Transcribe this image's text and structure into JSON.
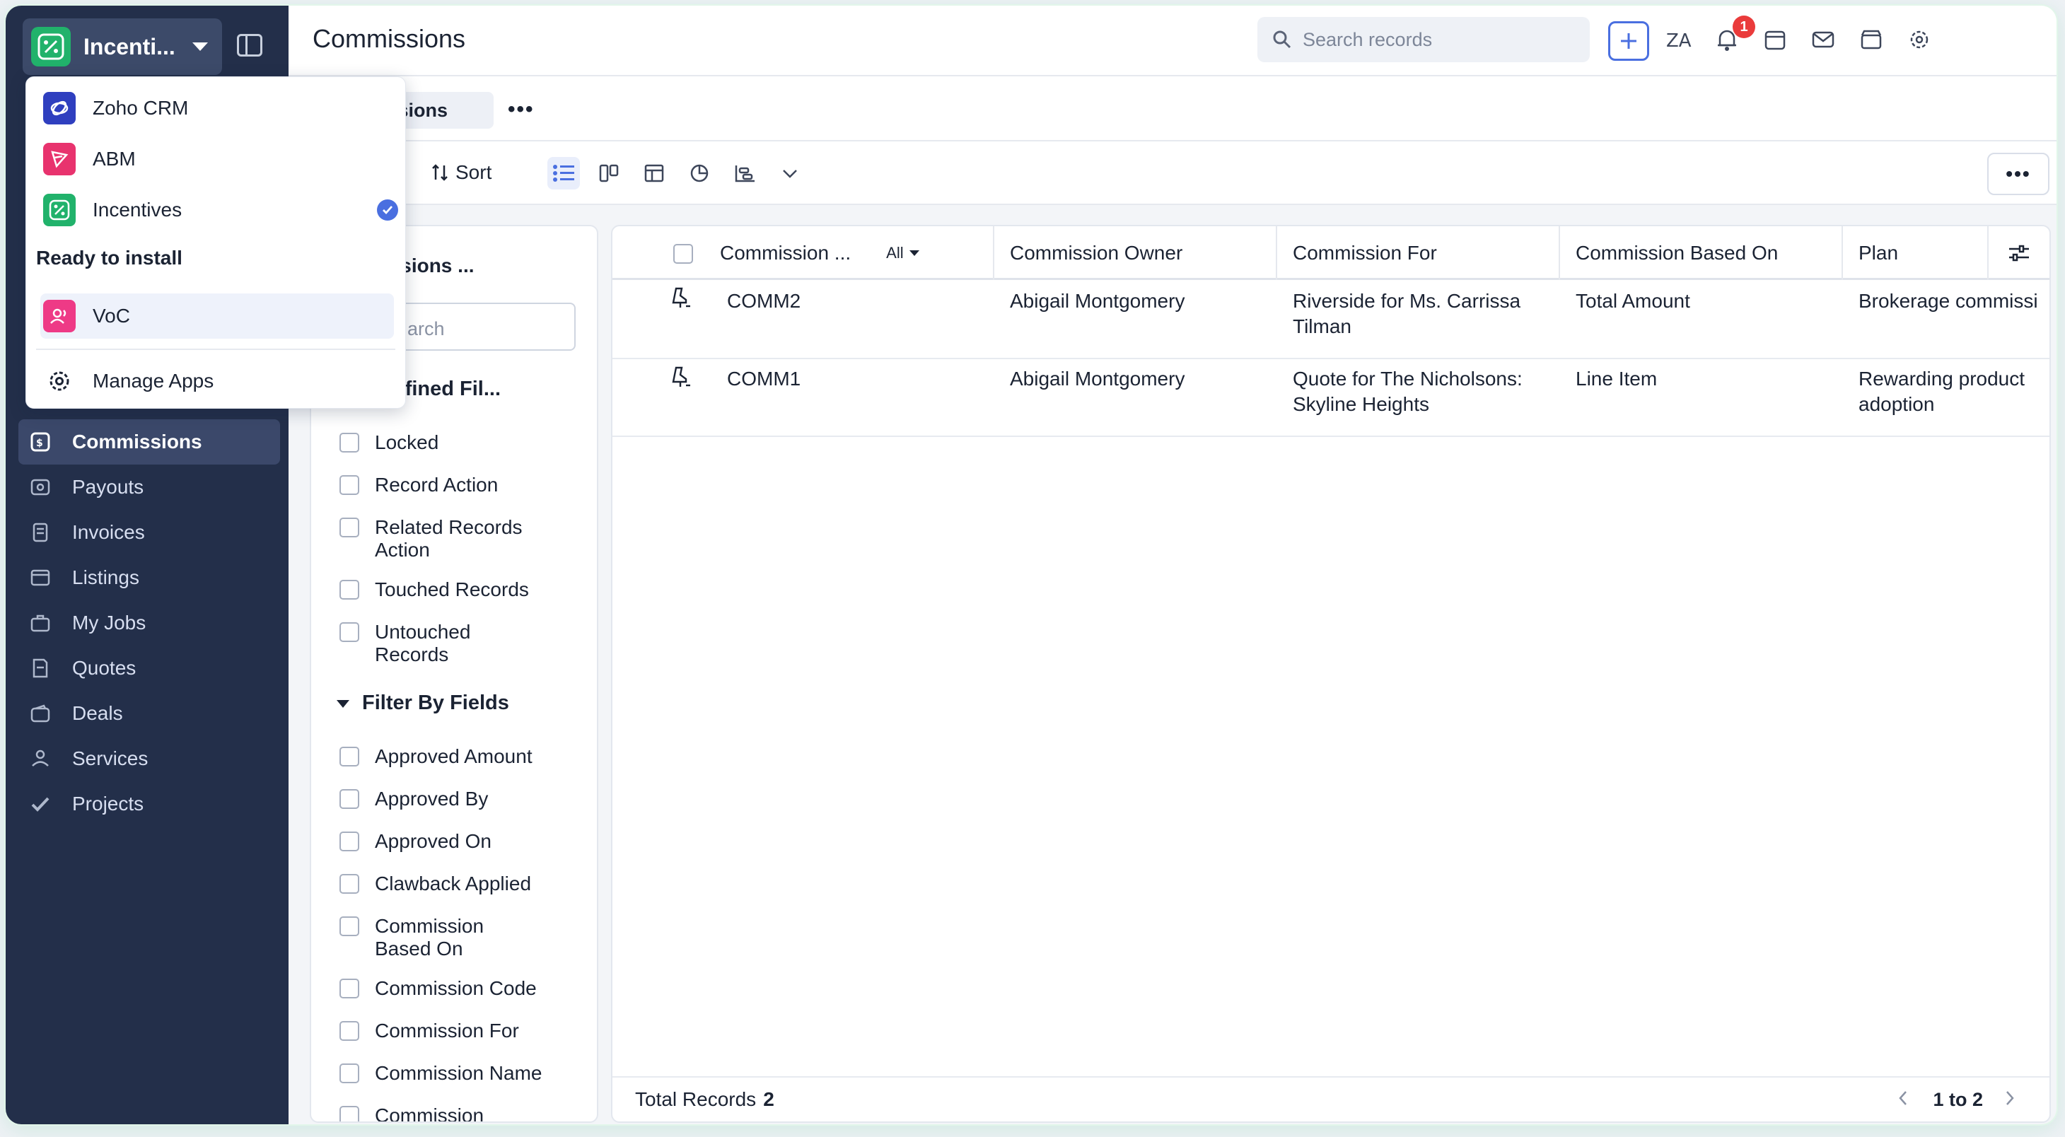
{
  "app_switcher": {
    "current_app": "Incenti...",
    "manage_apps": "Manage Apps"
  },
  "dropdown": {
    "installed": [
      {
        "label": "Zoho CRM",
        "color": "#2f3fbf",
        "selected": false
      },
      {
        "label": "ABM",
        "color": "#e8336e",
        "selected": false
      },
      {
        "label": "Incentives",
        "color": "#21b26b",
        "selected": true
      }
    ],
    "ready_section_label": "Ready to install",
    "ready": [
      {
        "label": "VoC",
        "color": "#ee3a86"
      }
    ]
  },
  "sidebar": {
    "items": [
      {
        "label": "Commissions",
        "icon": "commissions-icon",
        "active": true
      },
      {
        "label": "Payouts",
        "icon": "payouts-icon",
        "active": false
      },
      {
        "label": "Invoices",
        "icon": "invoices-icon",
        "active": false
      },
      {
        "label": "Listings",
        "icon": "listings-icon",
        "active": false
      },
      {
        "label": "My Jobs",
        "icon": "jobs-icon",
        "active": false
      },
      {
        "label": "Quotes",
        "icon": "quotes-icon",
        "active": false
      },
      {
        "label": "Deals",
        "icon": "deals-icon",
        "active": false
      },
      {
        "label": "Services",
        "icon": "services-icon",
        "active": false
      },
      {
        "label": "Projects",
        "icon": "projects-icon",
        "active": false
      }
    ]
  },
  "header": {
    "title": "Commissions",
    "search_placeholder": "Search records",
    "notification_count": "1"
  },
  "tabs": {
    "active_tab": "issions",
    "more": "•••"
  },
  "toolbar": {
    "sort_label": "Sort",
    "more_label": "•••"
  },
  "filter_panel": {
    "title": "ommissions ...",
    "search_placeholder": "arch",
    "system_section": "tem Defined Fil...",
    "system_filters": [
      "Locked",
      "Record Action",
      "Related Records Action",
      "Touched Records",
      "Untouched Records"
    ],
    "fields_section": "Filter By Fields",
    "field_filters": [
      "Approved Amount",
      "Approved By",
      "Approved On",
      "Clawback Applied",
      "Commission Based On",
      "Commission Code",
      "Commission For",
      "Commission Name",
      "Commission"
    ]
  },
  "table": {
    "columns": [
      "Commission ...",
      "Commission Owner",
      "Commission For",
      "Commission Based On",
      "Plan"
    ],
    "first_column_filter": "All",
    "rows": [
      {
        "code": "COMM2",
        "owner": "Abigail Montgomery",
        "for": "Riverside for Ms. Carrissa Tilman",
        "based_on": "Total Amount",
        "plan": "Brokerage commissi"
      },
      {
        "code": "COMM1",
        "owner": "Abigail Montgomery",
        "for": "Quote for The Nicholsons: Skyline Heights",
        "based_on": "Line Item",
        "plan": "Rewarding product adoption"
      }
    ],
    "footer_label": "Total Records",
    "footer_count": "2",
    "pagination": "1 to 2"
  }
}
